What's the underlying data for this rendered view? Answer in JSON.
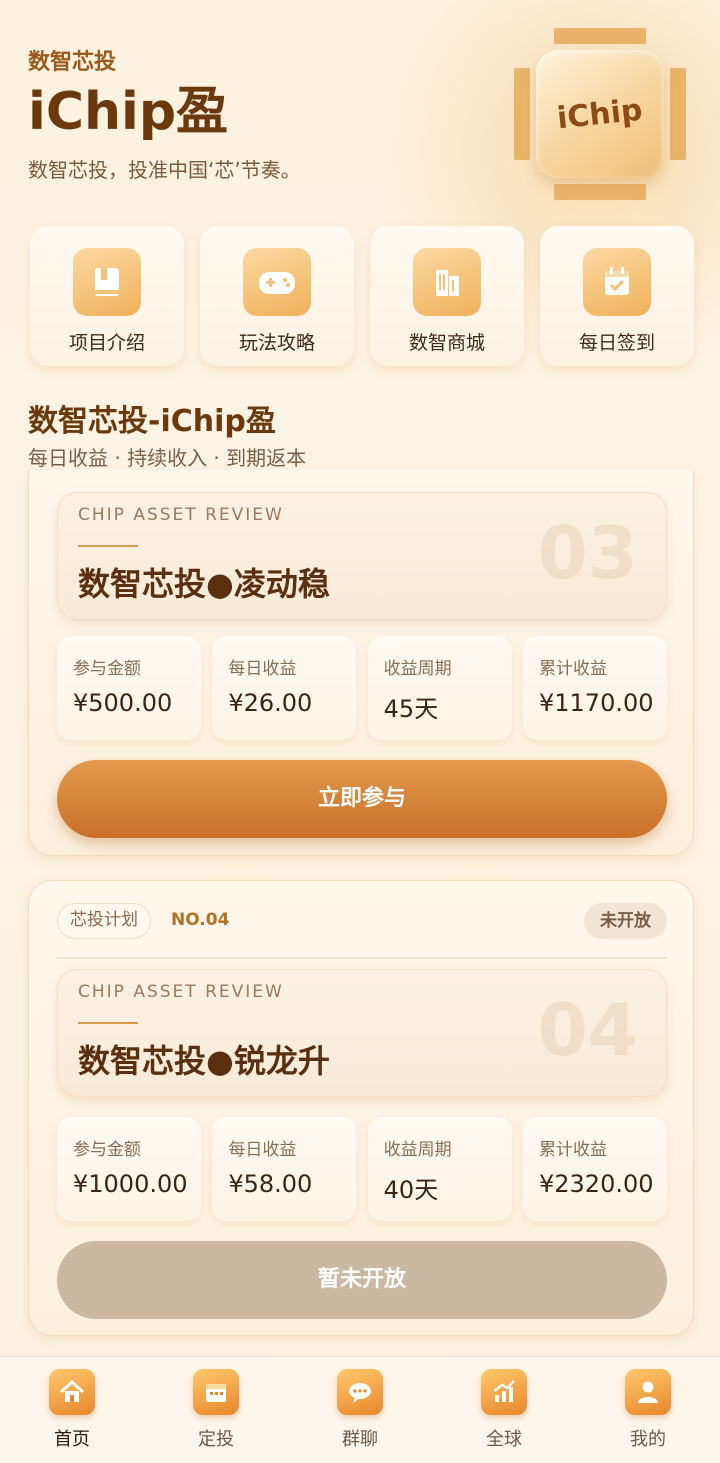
{
  "header": {
    "subtitle": "数智芯投",
    "title": "iChip盈",
    "description": "数智芯投，投准中国‘芯’节奏。",
    "logo_text": "iChip"
  },
  "menu": [
    {
      "label": "项目介绍",
      "icon": "book-icon"
    },
    {
      "label": "玩法攻略",
      "icon": "gamepad-icon"
    },
    {
      "label": "数智商城",
      "icon": "building-icon"
    },
    {
      "label": "每日签到",
      "icon": "calendar-check-icon"
    }
  ],
  "section": {
    "title": "数智芯投-iChip盈",
    "subtitle": "每日收益 · 持续收入 · 到期返本"
  },
  "cards": [
    {
      "review_en": "CHIP ASSET REVIEW",
      "name": "数智芯投●凌动稳",
      "number": "03",
      "stats": [
        {
          "label": "参与金额",
          "value": "¥500.00"
        },
        {
          "label": "每日收益",
          "value": "¥26.00"
        },
        {
          "label": "收益周期",
          "value": "45天"
        },
        {
          "label": "累计收益",
          "value": "¥1170.00"
        }
      ],
      "button": "立即参与"
    },
    {
      "tag": "芯投计划",
      "no": "NO.04",
      "status": "未开放",
      "review_en": "CHIP ASSET REVIEW",
      "name": "数智芯投●锐龙升",
      "number": "04",
      "stats": [
        {
          "label": "参与金额",
          "value": "¥1000.00"
        },
        {
          "label": "每日收益",
          "value": "¥58.00"
        },
        {
          "label": "收益周期",
          "value": "40天"
        },
        {
          "label": "累计收益",
          "value": "¥2320.00"
        }
      ],
      "button": "暂未开放"
    }
  ],
  "tabs": [
    {
      "label": "首页",
      "icon": "home-icon",
      "active": true
    },
    {
      "label": "定投",
      "icon": "calendar-icon"
    },
    {
      "label": "群聊",
      "icon": "chat-icon"
    },
    {
      "label": "全球",
      "icon": "growth-chart-icon"
    },
    {
      "label": "我的",
      "icon": "user-icon"
    }
  ],
  "colors": {
    "accent": "#c8702a",
    "title": "#6a3a0e",
    "disabled_button": "#cbb8a0"
  }
}
